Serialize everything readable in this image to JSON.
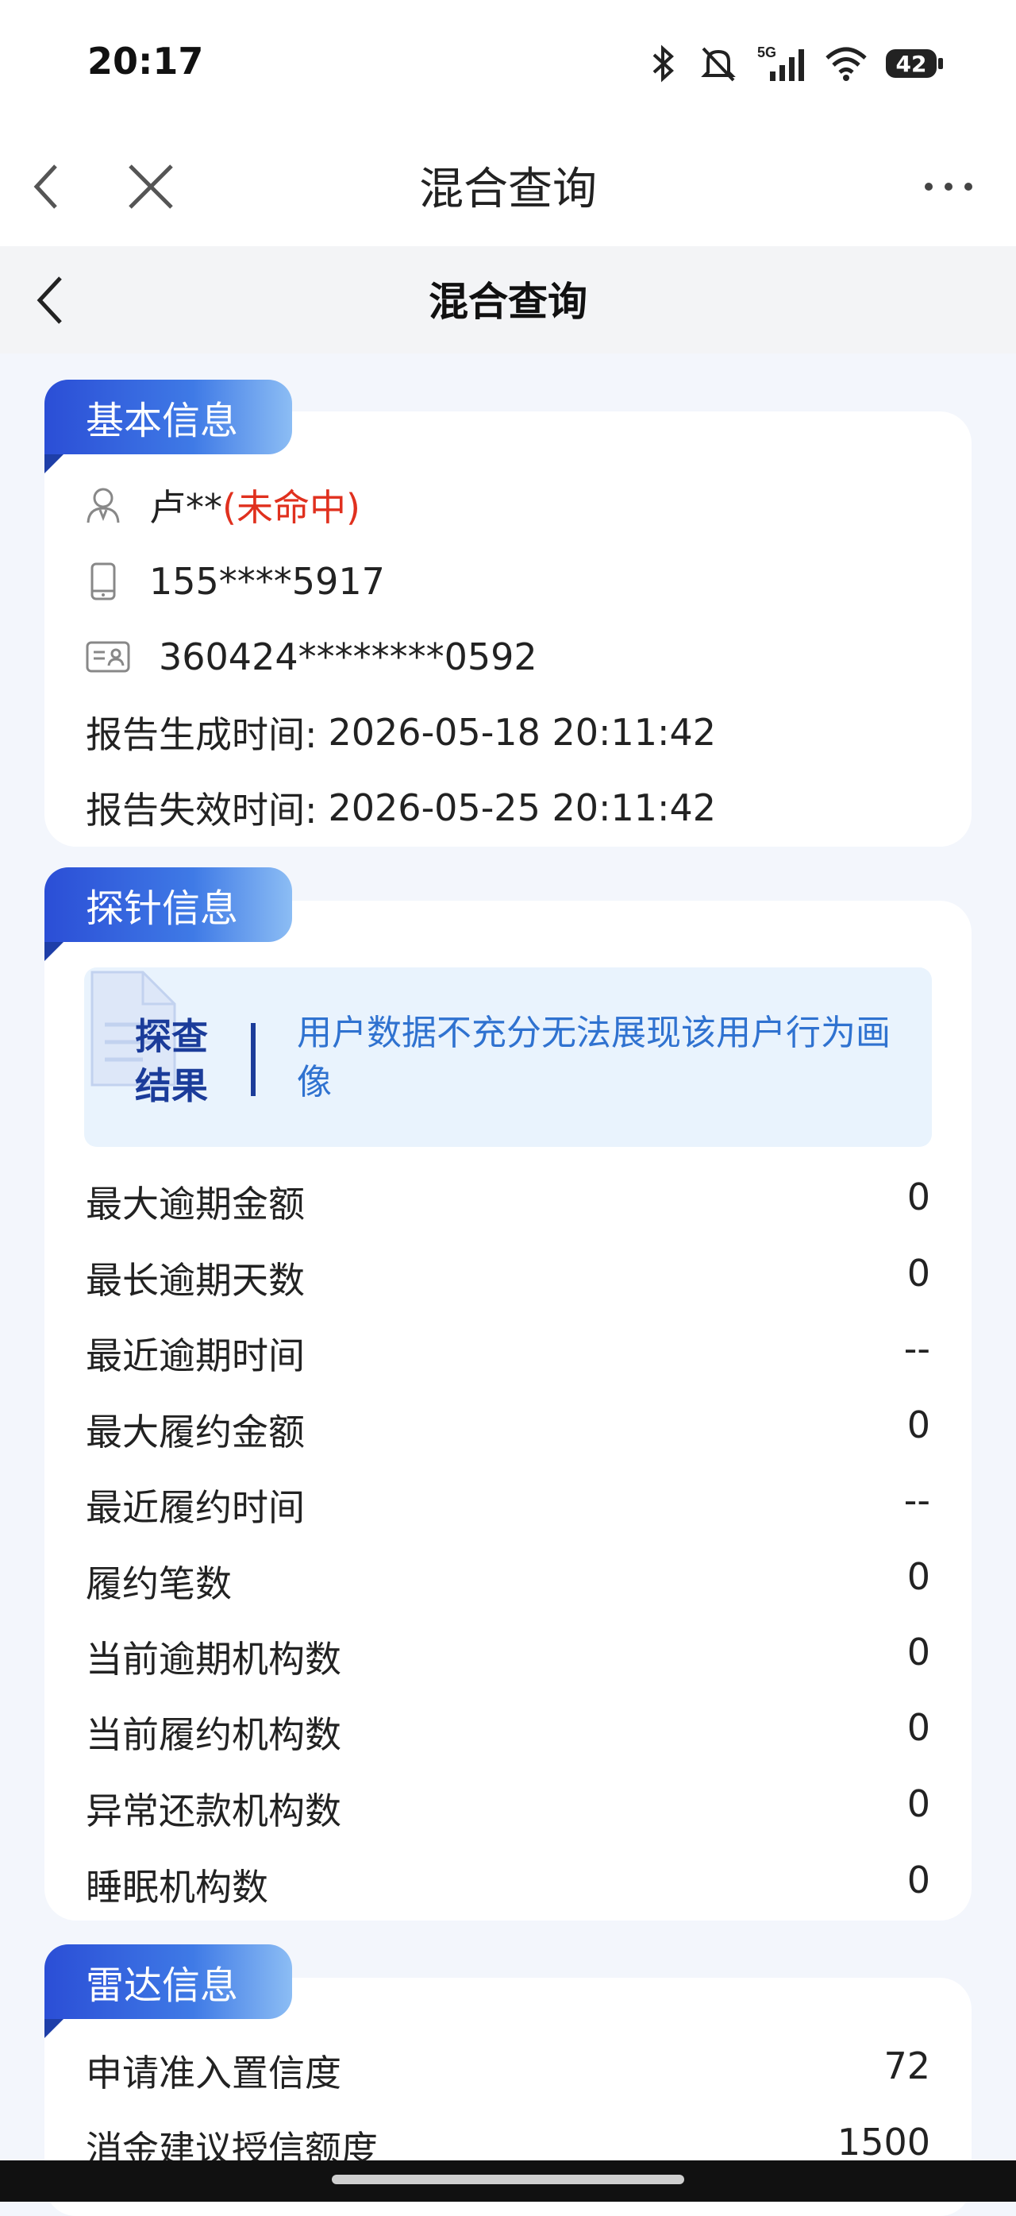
{
  "status_bar": {
    "time": "20:17",
    "network": "5G",
    "battery": "42"
  },
  "browser": {
    "title": "混合查询"
  },
  "page": {
    "title": "混合查询"
  },
  "basic_info": {
    "section_title": "基本信息",
    "name": "卢**",
    "name_status": "(未命中)",
    "phone": "155****5917",
    "id_number": "360424********0592",
    "report_generated_label": "报告生成时间:",
    "report_generated_value": "2026-05-18 20:11:42",
    "report_expires_label": "报告失效时间:",
    "report_expires_value": "2026-05-25 20:11:42"
  },
  "probe_info": {
    "section_title": "探针信息",
    "result_label_line1": "探查",
    "result_label_line2": "结果",
    "result_text": "用户数据不充分无法展现该用户行为画像",
    "rows": [
      {
        "label": "最大逾期金额",
        "value": "0"
      },
      {
        "label": "最长逾期天数",
        "value": "0"
      },
      {
        "label": "最近逾期时间",
        "value": "--"
      },
      {
        "label": "最大履约金额",
        "value": "0"
      },
      {
        "label": "最近履约时间",
        "value": "--"
      },
      {
        "label": "履约笔数",
        "value": "0"
      },
      {
        "label": "当前逾期机构数",
        "value": "0"
      },
      {
        "label": "当前履约机构数",
        "value": "0"
      },
      {
        "label": "异常还款机构数",
        "value": "0"
      },
      {
        "label": "睡眠机构数",
        "value": "0"
      }
    ]
  },
  "radar_info": {
    "section_title": "雷达信息",
    "rows": [
      {
        "label": "申请准入置信度",
        "value": "72"
      },
      {
        "label": "消金建议授信额度",
        "value": "1500"
      }
    ]
  }
}
